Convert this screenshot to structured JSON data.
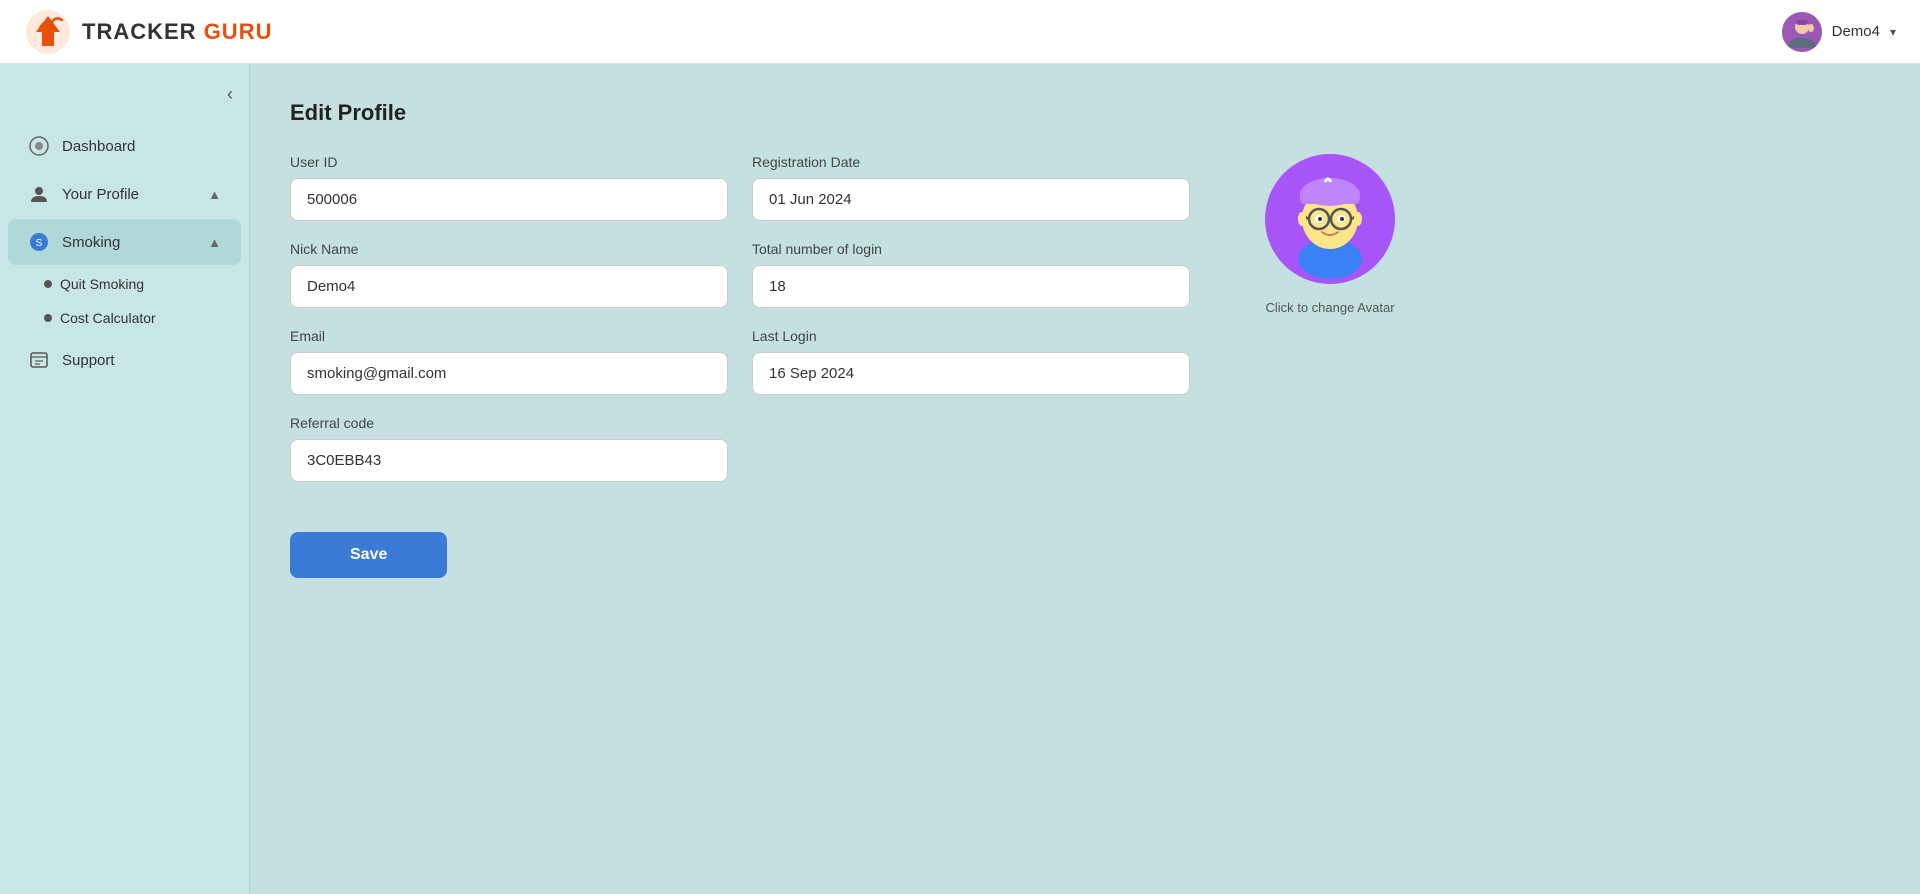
{
  "app": {
    "name_tracker": "TRACKER",
    "name_guru": "GURU"
  },
  "topbar": {
    "user_name": "Demo4",
    "user_chevron": "▾"
  },
  "sidebar": {
    "collapse_icon": "‹",
    "items": [
      {
        "id": "dashboard",
        "label": "Dashboard",
        "icon": "⊞",
        "active": false
      },
      {
        "id": "your-profile",
        "label": "Your Profile",
        "icon": "●",
        "active": true,
        "has_chevron": true,
        "chevron": "▲"
      },
      {
        "id": "smoking",
        "label": "Smoking",
        "icon": "●",
        "active": true,
        "has_chevron": true,
        "chevron": "▲"
      }
    ],
    "submenu_smoking": [
      {
        "id": "quit-smoking",
        "label": "Quit Smoking"
      },
      {
        "id": "cost-calculator",
        "label": "Cost Calculator"
      }
    ],
    "support": {
      "id": "support",
      "label": "Support",
      "icon": "📋"
    }
  },
  "page": {
    "title": "Edit Profile"
  },
  "form": {
    "user_id_label": "User ID",
    "user_id_value": "500006",
    "registration_date_label": "Registration Date",
    "registration_date_value": "01 Jun 2024",
    "nick_name_label": "Nick Name",
    "nick_name_value": "Demo4",
    "total_login_label": "Total number of login",
    "total_login_value": "18",
    "email_label": "Email",
    "email_value": "smoking@gmail.com",
    "last_login_label": "Last Login",
    "last_login_value": "16 Sep 2024",
    "referral_code_label": "Referral code",
    "referral_code_value": "3C0EBB43",
    "save_button": "Save"
  },
  "avatar": {
    "change_text": "Click to change Avatar"
  }
}
